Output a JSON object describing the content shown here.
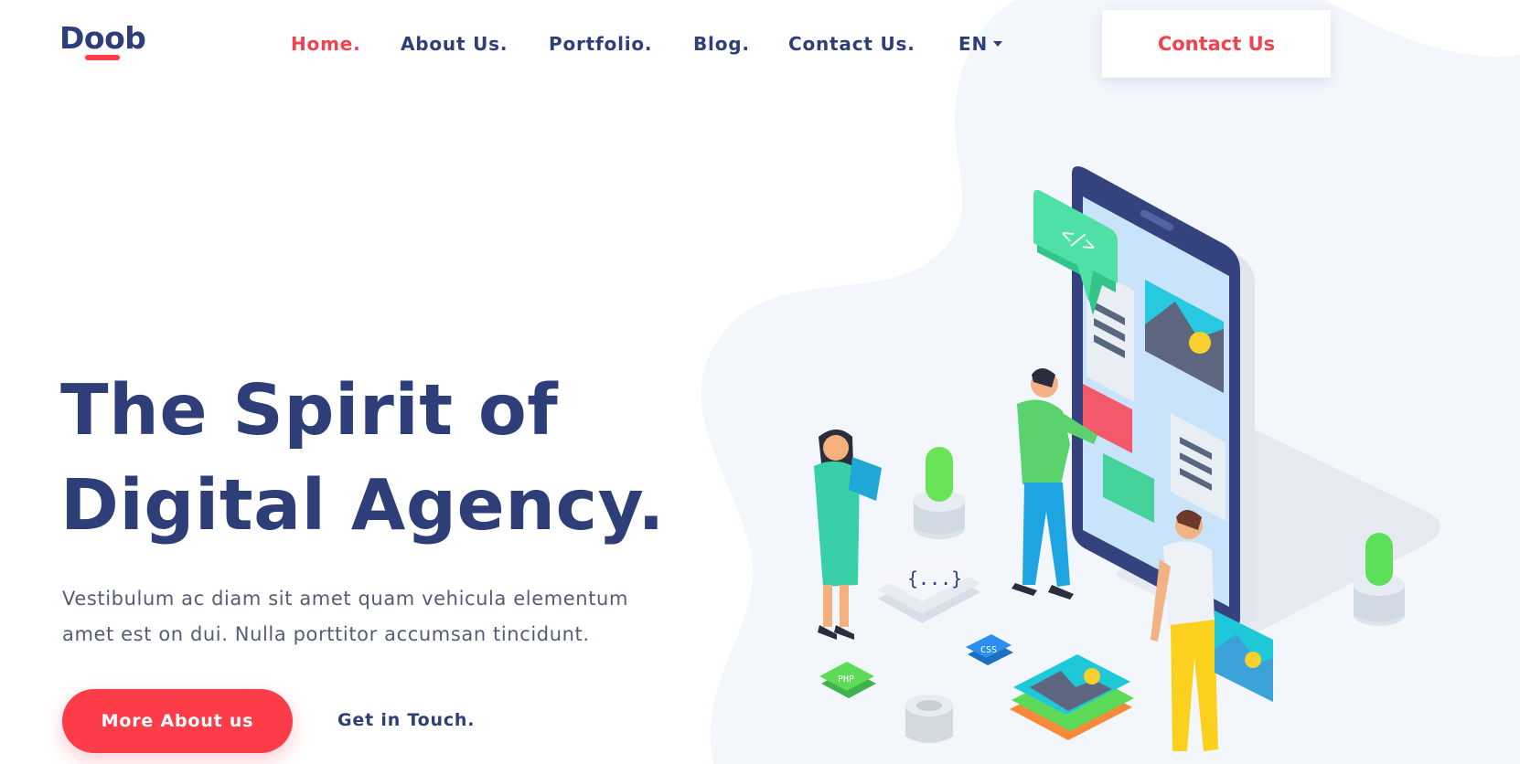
{
  "brand": {
    "logo_text": "Doob"
  },
  "nav": {
    "items": [
      {
        "label": "Home.",
        "active": true
      },
      {
        "label": "About Us.",
        "active": false
      },
      {
        "label": "Portfolio.",
        "active": false
      },
      {
        "label": "Blog.",
        "active": false
      },
      {
        "label": "Contact Us.",
        "active": false
      }
    ],
    "language": {
      "selected": "EN"
    },
    "cta_label": "Contact Us"
  },
  "hero": {
    "title_lines": [
      "The Spirit of",
      "Digital Agency."
    ],
    "description_lines": [
      "Vestibulum ac diam sit amet quam vehicula elementum",
      "amet est on dui. Nulla porttitor accumsan tincidunt."
    ],
    "primary_button_label": "More About us",
    "secondary_link_label": "Get in Touch."
  },
  "illustration": {
    "code_bubble_text": "</>",
    "braces_text": "{...}",
    "css_tag": "CSS",
    "php_tag": "PHP"
  },
  "colors": {
    "accent": "#fd3c4a",
    "accent_text": "#f0424f",
    "navy": "#2d3e78",
    "body_text": "#555d74",
    "blob_bg": "#f3f7fc"
  }
}
